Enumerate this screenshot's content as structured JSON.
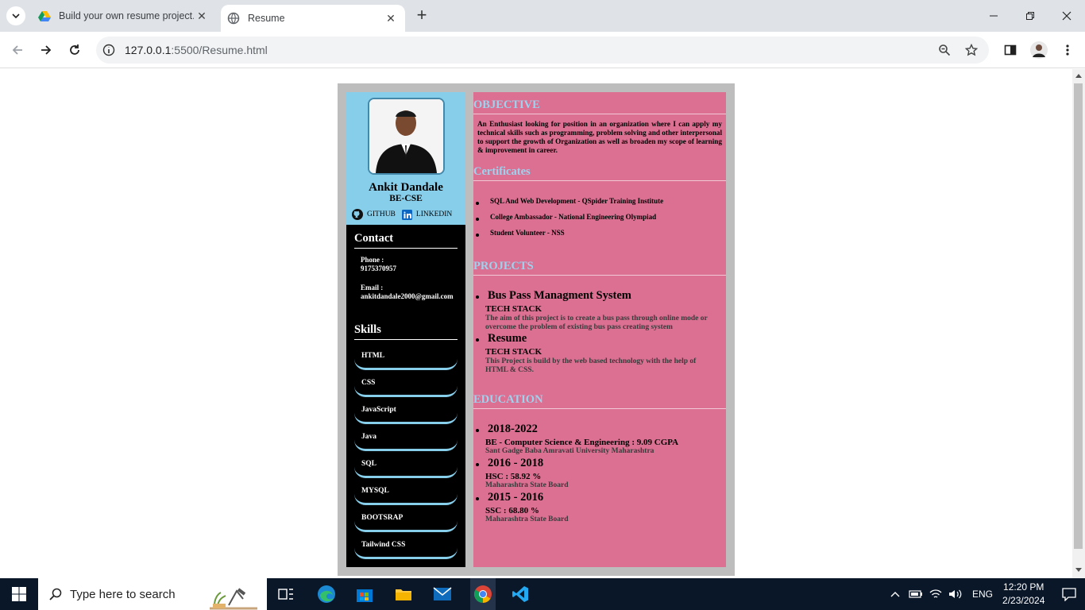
{
  "browser": {
    "tabs": [
      {
        "title": "Build your own resume project..."
      },
      {
        "title": "Resume"
      }
    ],
    "url_host": "127.0.0.1",
    "url_path": ":5500/Resume.html"
  },
  "resume": {
    "name": "Ankit Dandale",
    "degree": "BE-CSE",
    "links": {
      "github": "GITHUB",
      "linkedin": "LINKEDIN"
    },
    "contact": {
      "heading": "Contact",
      "phone_label": "Phone :",
      "phone": "9175370957",
      "email_label": "Email :",
      "email": "ankitdandale2000@gmail.com"
    },
    "skills_heading": "Skills",
    "skills": [
      "HTML",
      "CSS",
      "JavaScript",
      "Java",
      "SQL",
      "MYSQL",
      "BOOTSRAP",
      "Tailwind CSS"
    ],
    "objective_heading": "OBJECTIVE",
    "objective": "An Enthusiast looking for position in an organization where I can apply my technical skills such as programming, problem solving and other interpersonal to support the growth of Organization as well as broaden my scope of learning & improvement in career.",
    "certificates_heading": "Certificates",
    "certificates": [
      "SQL And Web Development - QSpider Training Institute",
      "College Ambassador - National Engineering Olympiad",
      "Student Volunteer - NSS"
    ],
    "projects_heading": "PROJECTS",
    "projects": [
      {
        "title": "Bus Pass Managment System",
        "sub": "TECH STACK",
        "desc": "The aim of this project is to create a bus pass through online mode or overcome the problem of existing bus pass creating system"
      },
      {
        "title": "Resume",
        "sub": "TECH STACK",
        "desc": "This Project is build by the web based technology with the help of HTML & CSS."
      }
    ],
    "education_heading": "EDUCATION",
    "education": [
      {
        "years": "2018-2022",
        "detail": "BE - Computer Science & Engineering : 9.09 CGPA",
        "inst": "Sant Gadge Baba Amravati University Maharashtra"
      },
      {
        "years": "2016 - 2018",
        "detail": "HSC : 58.92 %",
        "inst": "Maharashtra State Board"
      },
      {
        "years": "2015 - 2016",
        "detail": "SSC : 68.80 %",
        "inst": "Maharashtra State Board"
      }
    ]
  },
  "taskbar": {
    "search_placeholder": "Type here to search",
    "time": "12:20 PM",
    "date": "2/23/2024",
    "lang": "ENG"
  }
}
